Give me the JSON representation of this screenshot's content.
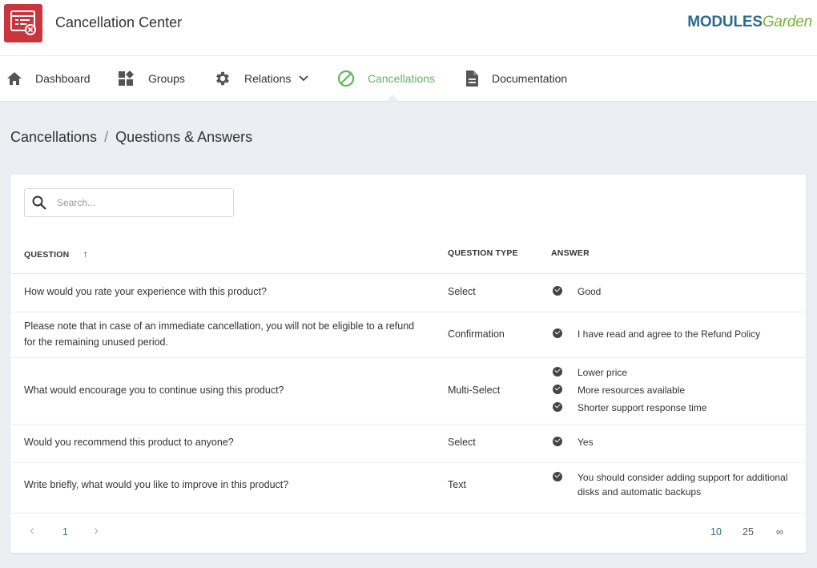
{
  "app": {
    "title": "Cancellation Center",
    "logo_part1": "MODULES",
    "logo_part2": "Garden"
  },
  "nav": {
    "items": [
      {
        "label": "Dashboard",
        "icon": "home-icon"
      },
      {
        "label": "Groups",
        "icon": "widgets-icon"
      },
      {
        "label": "Relations",
        "icon": "gear-icon"
      },
      {
        "label": "Cancellations",
        "icon": "block-icon",
        "active": true
      },
      {
        "label": "Documentation",
        "icon": "document-icon"
      }
    ]
  },
  "breadcrumb": {
    "parent": "Cancellations",
    "separator": "/",
    "current": "Questions & Answers"
  },
  "search": {
    "placeholder": "Search..."
  },
  "table": {
    "headers": {
      "question": "QUESTION",
      "sort_indicator": "↑",
      "type": "QUESTION TYPE",
      "answer": "ANSWER"
    },
    "rows": [
      {
        "question": "How would you rate your experience with this product?",
        "type": "Select",
        "answers": [
          "Good"
        ]
      },
      {
        "question_lines": [
          "Please note that in case of an immediate cancellation, you will not be eligible to a refund",
          "for the remaining unused period."
        ],
        "type": "Confirmation",
        "answers": [
          "I have read and agree to the Refund Policy"
        ]
      },
      {
        "question": "What would encourage you to continue using this product?",
        "type": "Multi-Select",
        "answers": [
          "Lower price",
          "More resources available",
          "Shorter support response time"
        ]
      },
      {
        "question": "Would you recommend this product to anyone?",
        "type": "Select",
        "answers": [
          "Yes"
        ]
      },
      {
        "question": "Write briefly, what would you like to improve in this product?",
        "type": "Text",
        "answer_lines": [
          "You should consider adding support for additional",
          "disks and automatic backups"
        ]
      }
    ]
  },
  "pagination": {
    "prev": "‹",
    "current_page": "1",
    "next": "›",
    "page_sizes": [
      "10",
      "25",
      "∞"
    ],
    "active_size": "10"
  },
  "colors": {
    "accent_green": "#5cb85c",
    "brand_red": "#c9343d",
    "link_blue": "#2a6a8f"
  }
}
